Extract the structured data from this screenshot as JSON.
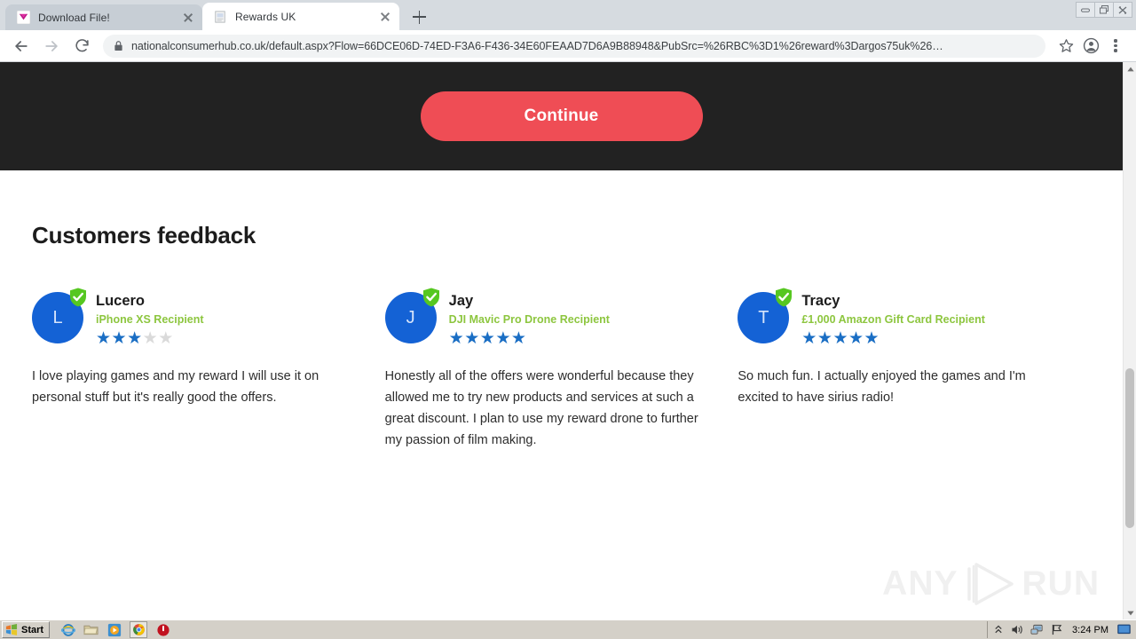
{
  "browser": {
    "tabs": [
      {
        "title": "Download File!",
        "favicon": "magenta-chevron-icon",
        "active": false
      },
      {
        "title": "Rewards UK",
        "favicon": "generic-page-icon",
        "active": true
      }
    ],
    "new_tab_label": "+",
    "window_controls": [
      "minimize",
      "restore",
      "close"
    ],
    "nav": {
      "back": "back-arrow",
      "forward": "forward-arrow",
      "reload": "reload-arrow"
    },
    "omnibox": {
      "lock_icon": "padlock-icon",
      "url": "nationalconsumerhub.co.uk/default.aspx?Flow=66DCE06D-74ED-F3A6-F436-34E60FEAAD7D6A9B88948&PubSrc=%26RBC%3D1%26reward%3Dargos75uk%26…"
    },
    "toolbar_icons": [
      "bookmark-star-icon",
      "profile-avatar-icon",
      "chrome-menu-icon"
    ]
  },
  "page": {
    "cta": {
      "label": "Continue",
      "color": "#ef4d55"
    },
    "section_title": "Customers feedback",
    "testimonials": [
      {
        "initial": "L",
        "name": "Lucero",
        "role": "iPhone XS Recipient",
        "rating": 3,
        "max_rating": 5,
        "text": "I love playing games and my reward I will use it on personal stuff but it's really good the offers."
      },
      {
        "initial": "J",
        "name": "Jay",
        "role": "DJI Mavic Pro Drone Recipient",
        "rating": 5,
        "max_rating": 5,
        "text": "Honestly all of the offers were wonderful because they allowed me to try new products and services at such a great discount. I plan to use my reward drone to further my passion of film making."
      },
      {
        "initial": "T",
        "name": "Tracy",
        "role": "£1,000 Amazon Gift Card Recipient",
        "rating": 5,
        "max_rating": 5,
        "text": "So much fun. I actually enjoyed the games and I'm excited to have sirius radio!"
      }
    ],
    "colors": {
      "dark_band": "#222222",
      "avatar_blue": "#1462d5",
      "role_green": "#8dc63f",
      "star_filled": "#1a6ec4",
      "star_empty": "#dadada"
    },
    "watermark": {
      "left": "ANY",
      "right": "RUN",
      "logo": "play-triangle-icon"
    }
  },
  "taskbar": {
    "start_label": "Start",
    "quick_launch": [
      "internet-explorer-icon",
      "folder-icon",
      "media-player-icon",
      "chrome-icon",
      "shutdown-icon"
    ],
    "tray_icons": [
      "show-hidden-icons",
      "volume-icon",
      "network-icon",
      "flag-icon"
    ],
    "clock": "3:24 PM",
    "desktop_icon": "show-desktop-icon"
  }
}
